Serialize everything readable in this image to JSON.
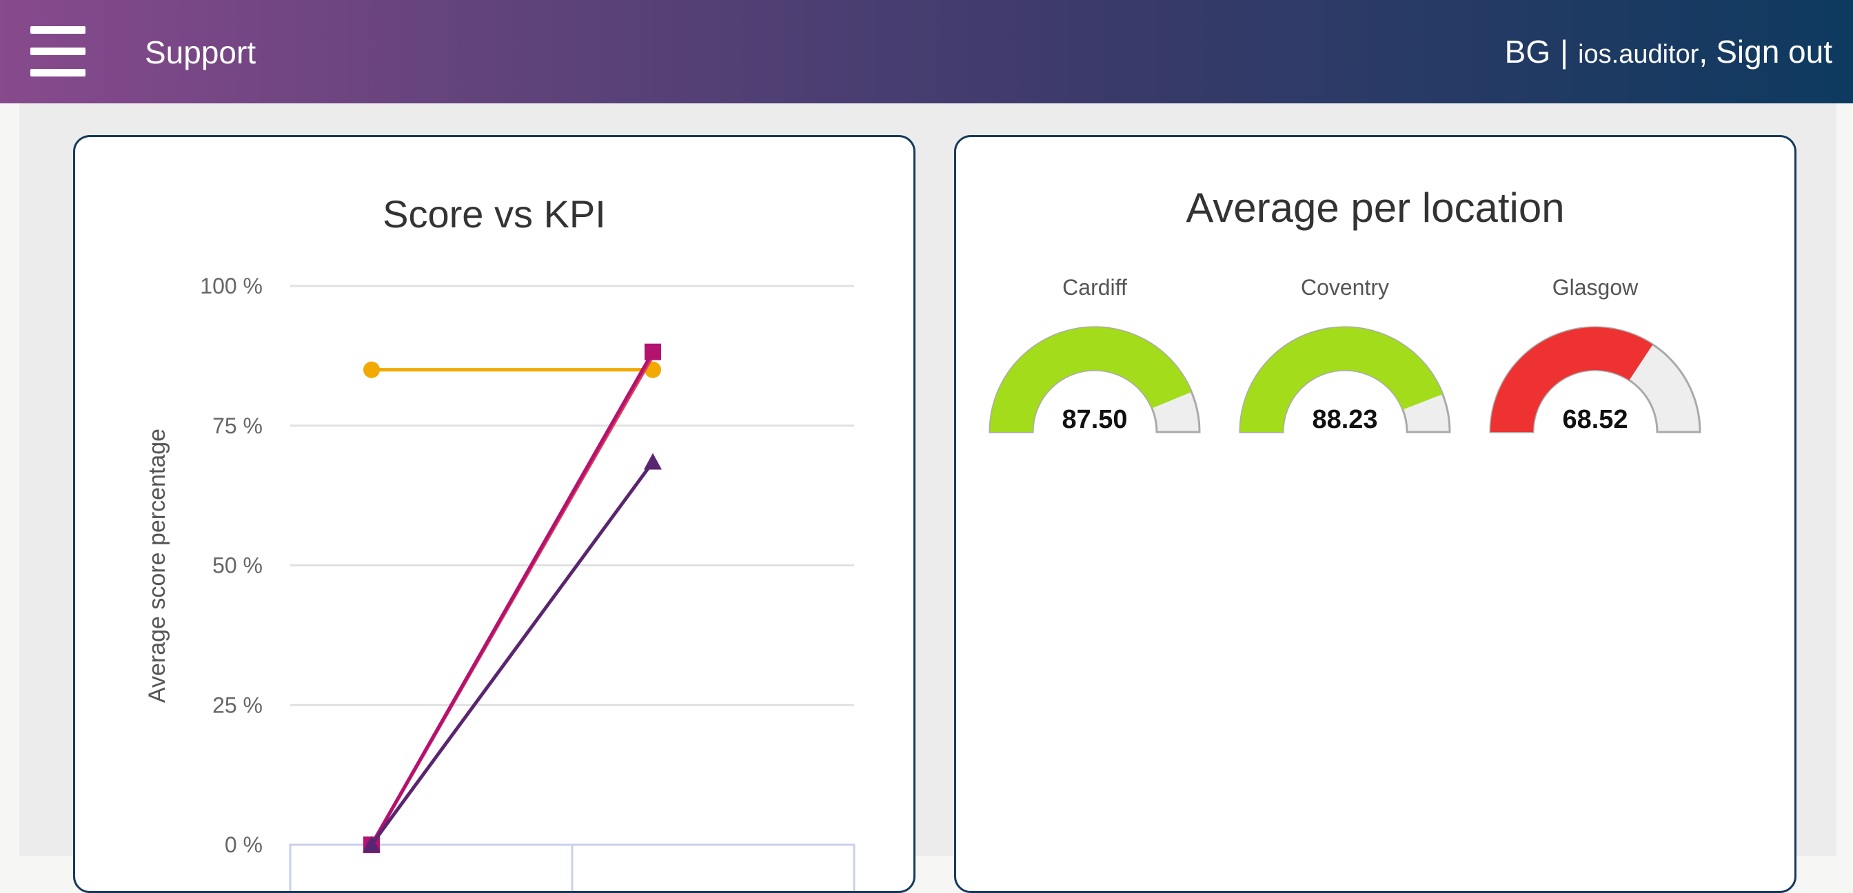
{
  "header": {
    "app_title": "Support",
    "menu_icon": "hamburger-menu-icon",
    "user_initials": "BG",
    "separator": "|",
    "username": "ios.auditor",
    "comma": ",",
    "sign_out_label": "Sign out"
  },
  "score_card": {
    "title": "Score vs KPI"
  },
  "location_card": {
    "title": "Average per location",
    "gauges": [
      {
        "location": "Cardiff",
        "value_label": "87.50",
        "value": 87.5,
        "color": "#a2dc1a"
      },
      {
        "location": "Coventry",
        "value_label": "88.23",
        "value": 88.23,
        "color": "#a2dc1a"
      },
      {
        "location": "Glasgow",
        "value_label": "68.52",
        "value": 68.52,
        "color": "#ee3232"
      }
    ],
    "gauge_track_color": "#eeeeee"
  },
  "chart_data": {
    "type": "line",
    "title": "Score vs KPI",
    "ylabel": "Average score percentage",
    "xlabel": "",
    "ylim": [
      0,
      100
    ],
    "ytick_labels": [
      "0 %",
      "25 %",
      "50 %",
      "75 %",
      "100 %"
    ],
    "yticks": [
      0,
      25,
      50,
      75,
      100
    ],
    "grid": true,
    "x": [
      0,
      1
    ],
    "series": [
      {
        "values": [
          85,
          85
        ],
        "color": "#f2a900",
        "marker": "circle"
      },
      {
        "values": [
          0,
          87.5
        ],
        "color": "#e03c5a",
        "marker": "none"
      },
      {
        "values": [
          0,
          88.2
        ],
        "color": "#b3126f",
        "marker": "square"
      },
      {
        "values": [
          0,
          68.5
        ],
        "color": "#5a2570",
        "marker": "triangle"
      }
    ]
  }
}
